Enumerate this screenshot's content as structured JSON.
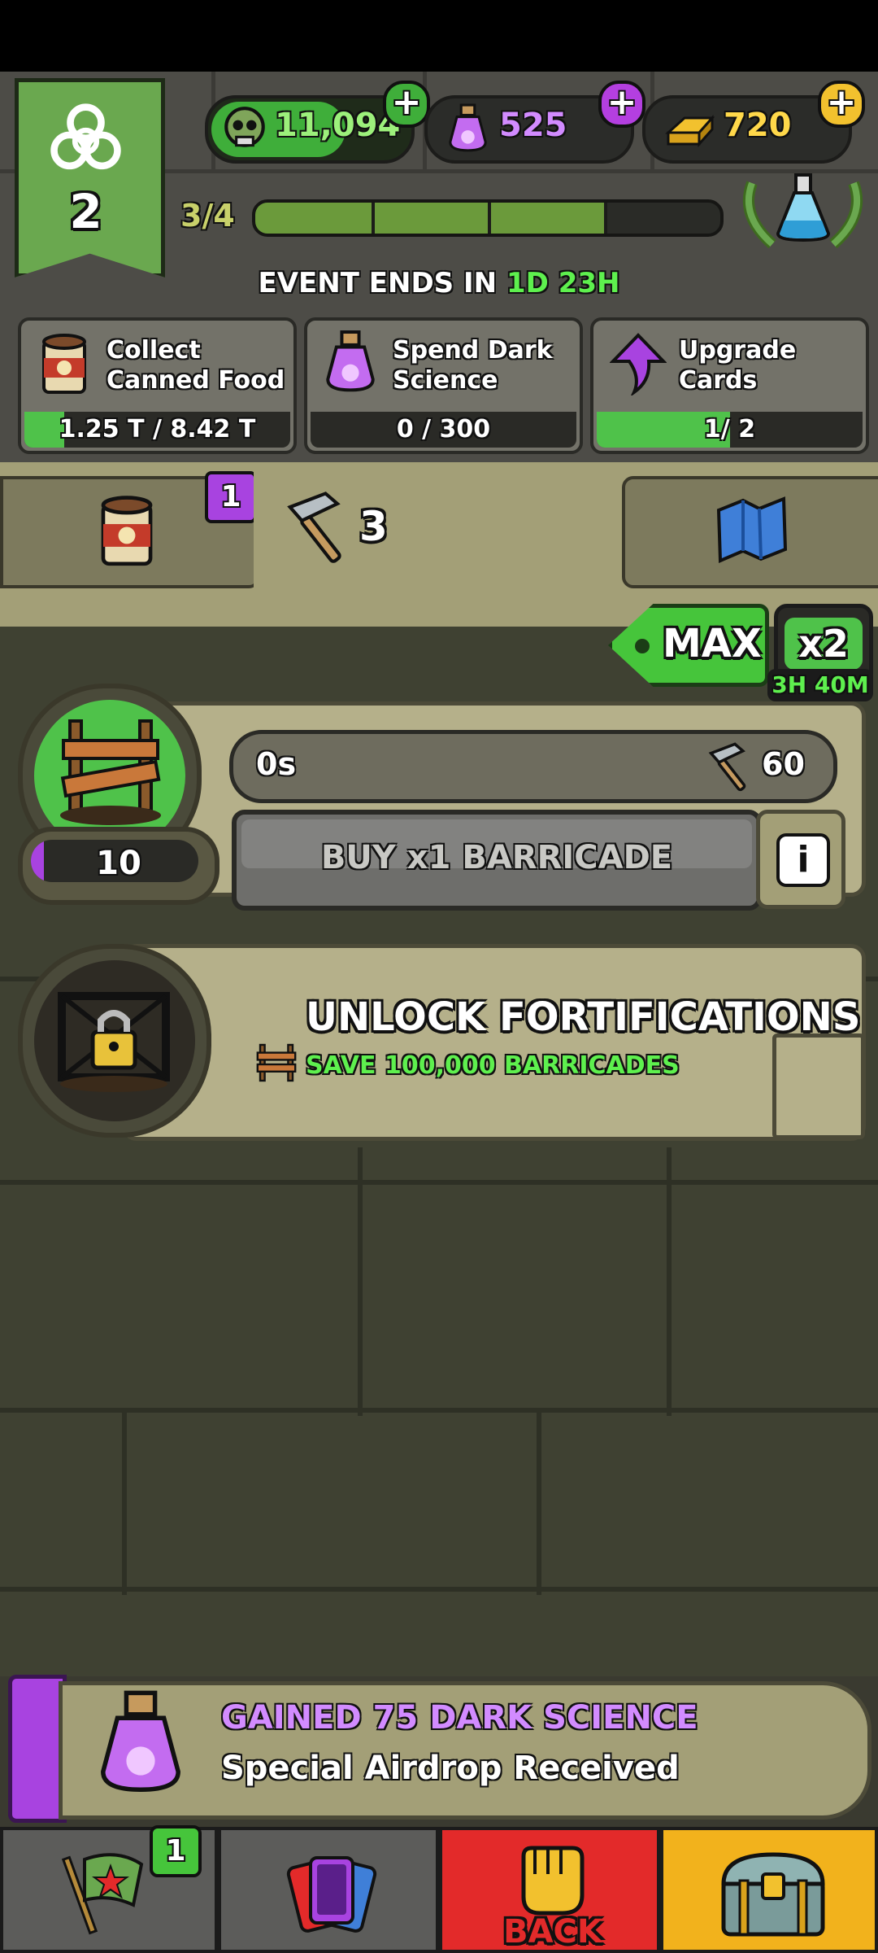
{
  "level": "2",
  "currencies": {
    "zombies": "11,094",
    "dark_science": "525",
    "gold": "720"
  },
  "progress": {
    "label": "3/4",
    "fraction": 0.75
  },
  "event": {
    "prefix": "EVENT ENDS IN",
    "days": "1D",
    "hours": "23H"
  },
  "quests": [
    {
      "label_line1": "Collect",
      "label_line2": "Canned Food",
      "progress": "1.25 T / 8.42 T",
      "fill": 0.15
    },
    {
      "label_line1": "Spend Dark",
      "label_line2": "Science",
      "progress": "0 / 300",
      "fill": 0
    },
    {
      "label_line1": "Upgrade",
      "label_line2": "Cards",
      "progress": "1/ 2",
      "fill": 0.5
    }
  ],
  "tabs": {
    "canned_badge": "1",
    "hammer_count": "3"
  },
  "multiplier": {
    "max_label": "MAX",
    "x2_label": "x2",
    "timer": "3H 40M"
  },
  "barricade": {
    "count": "10",
    "timer": "0s",
    "hammer_cost": "60",
    "buy_label": "BUY x1 BARRICADE",
    "info": "i"
  },
  "fortifications": {
    "title": "UNLOCK FORTIFICATIONS",
    "subtitle": "SAVE 100,000 BARRICADES"
  },
  "notification": {
    "title": "GAINED 75 DARK SCIENCE",
    "subtitle": "Special Airdrop Received"
  },
  "nav": {
    "flag_badge": "1",
    "back_label": "BACK"
  },
  "colors": {
    "green": "#6aa84f",
    "purple": "#b43fe0",
    "gold": "#f2c12e",
    "red": "#e32a2a"
  }
}
